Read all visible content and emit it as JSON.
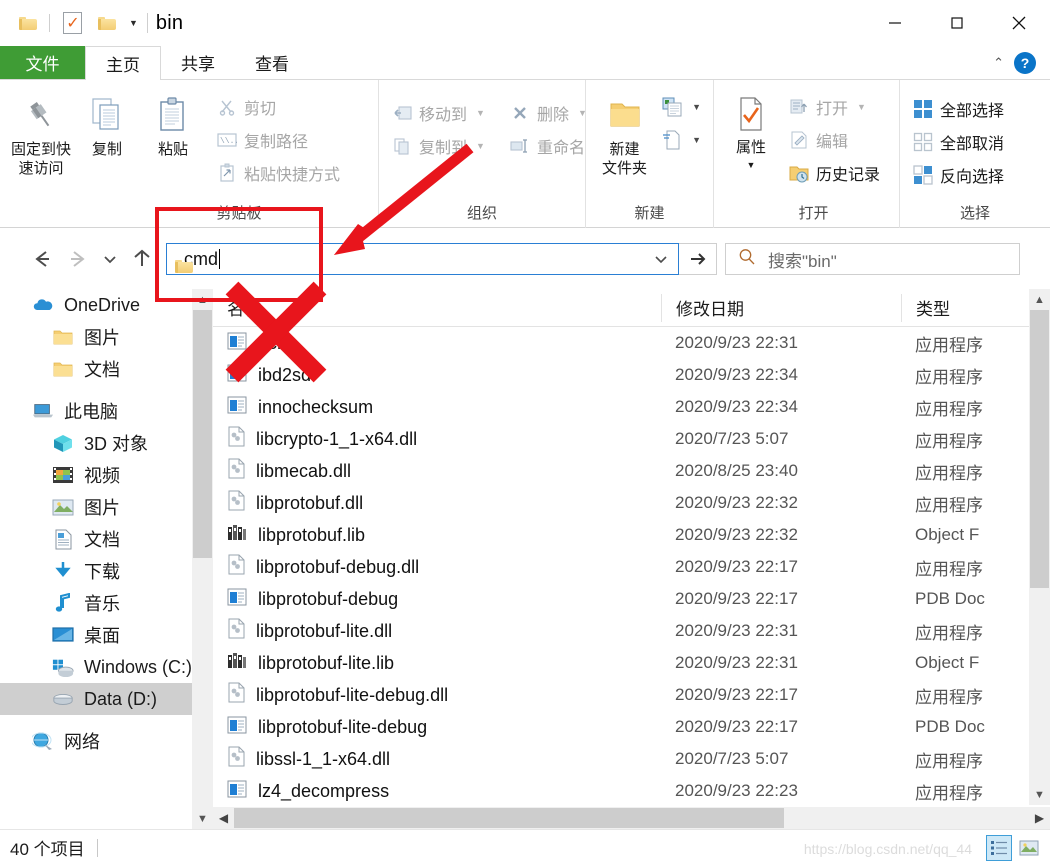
{
  "window": {
    "title": "bin",
    "controls": {
      "minimize": "minimize-button",
      "maximize": "maximize-button",
      "close": "close-button"
    }
  },
  "quick_access_toolbar": {
    "items": [
      "folder-icon",
      "properties-icon",
      "new-folder-icon"
    ],
    "dropdown": "⌄"
  },
  "tabs": [
    {
      "label": "文件",
      "active": false,
      "kind": "file"
    },
    {
      "label": "主页",
      "active": true,
      "kind": "normal"
    },
    {
      "label": "共享",
      "active": false,
      "kind": "normal"
    },
    {
      "label": "查看",
      "active": false,
      "kind": "normal"
    }
  ],
  "tab_right": {
    "collapse": "⌃",
    "help": "?"
  },
  "ribbon": {
    "groups": [
      {
        "label": "剪贴板",
        "big_buttons": [
          {
            "label": "固定到快\n速访问",
            "line1": "固定到快",
            "line2": "速访问",
            "icon": "pin-icon"
          },
          {
            "label": "复制",
            "line1": "复制",
            "line2": "",
            "icon": "copy-icon"
          },
          {
            "label": "粘贴",
            "line1": "粘贴",
            "line2": "",
            "icon": "paste-icon"
          }
        ],
        "small_buttons": [
          {
            "label": "剪切",
            "icon": "scissors-icon",
            "disabled": true,
            "caret": false
          },
          {
            "label": "复制路径",
            "icon": "copy-path-icon",
            "disabled": true,
            "caret": false
          },
          {
            "label": "粘贴快捷方式",
            "icon": "paste-shortcut-icon",
            "disabled": true,
            "caret": false
          }
        ]
      },
      {
        "label": "组织",
        "small_buttons": [
          {
            "label": "移动到",
            "icon": "move-to-icon",
            "disabled": true,
            "caret": true
          },
          {
            "label": "复制到",
            "icon": "copy-to-icon",
            "disabled": true,
            "caret": true
          },
          {
            "label": "删除",
            "icon": "delete-icon",
            "disabled": true,
            "caret": true
          },
          {
            "label": "重命名",
            "icon": "rename-icon",
            "disabled": true,
            "caret": false
          }
        ]
      },
      {
        "label": "新建",
        "big_buttons": [
          {
            "line1": "新建",
            "line2": "文件夹",
            "icon": "new-folder-icon"
          }
        ],
        "small_buttons": [
          {
            "label": "",
            "icon": "new-item-icon",
            "disabled": false,
            "caret": true
          },
          {
            "label": "",
            "icon": "easy-access-icon",
            "disabled": false,
            "caret": true
          }
        ]
      },
      {
        "label": "打开",
        "big_buttons": [
          {
            "line1": "属性",
            "line2": "",
            "icon": "properties-icon",
            "caret": true
          }
        ],
        "small_buttons": [
          {
            "label": "打开",
            "icon": "open-icon",
            "disabled": true,
            "caret": true
          },
          {
            "label": "编辑",
            "icon": "edit-icon",
            "disabled": true,
            "caret": false
          },
          {
            "label": "历史记录",
            "icon": "history-icon",
            "disabled": false,
            "caret": false
          }
        ]
      },
      {
        "label": "选择",
        "small_buttons": [
          {
            "label": "全部选择",
            "icon": "select-all-icon",
            "disabled": false,
            "caret": false
          },
          {
            "label": "全部取消",
            "icon": "select-none-icon",
            "disabled": false,
            "caret": false
          },
          {
            "label": "反向选择",
            "icon": "invert-selection-icon",
            "disabled": false,
            "caret": false
          }
        ]
      }
    ]
  },
  "navbar": {
    "back": "←",
    "forward": "→",
    "recent": "⌄",
    "up": "↑",
    "address_value": "cmd",
    "address_dropdown": "⌄",
    "go": "→",
    "search_placeholder": "搜索\"bin\""
  },
  "sidebar": {
    "items": [
      {
        "label": "OneDrive",
        "icon": "onedrive-cloud-icon",
        "indent": 0,
        "selected": false,
        "spacer_before": false
      },
      {
        "label": "图片",
        "icon": "folder-icon",
        "indent": 1,
        "selected": false,
        "spacer_before": false
      },
      {
        "label": "文档",
        "icon": "folder-icon",
        "indent": 1,
        "selected": false,
        "spacer_before": false
      },
      {
        "label": "此电脑",
        "icon": "this-pc-icon",
        "indent": 0,
        "selected": false,
        "spacer_before": true
      },
      {
        "label": "3D 对象",
        "icon": "3d-objects-icon",
        "indent": 1,
        "selected": false,
        "spacer_before": false
      },
      {
        "label": "视频",
        "icon": "videos-icon",
        "indent": 1,
        "selected": false,
        "spacer_before": false
      },
      {
        "label": "图片",
        "icon": "pictures-icon",
        "indent": 1,
        "selected": false,
        "spacer_before": false
      },
      {
        "label": "文档",
        "icon": "documents-icon",
        "indent": 1,
        "selected": false,
        "spacer_before": false
      },
      {
        "label": "下载",
        "icon": "downloads-icon",
        "indent": 1,
        "selected": false,
        "spacer_before": false
      },
      {
        "label": "音乐",
        "icon": "music-icon",
        "indent": 1,
        "selected": false,
        "spacer_before": false
      },
      {
        "label": "桌面",
        "icon": "desktop-icon",
        "indent": 1,
        "selected": false,
        "spacer_before": false
      },
      {
        "label": "Windows (C:)",
        "icon": "windows-drive-icon",
        "indent": 1,
        "selected": false,
        "spacer_before": false
      },
      {
        "label": "Data (D:)",
        "icon": "drive-icon",
        "indent": 1,
        "selected": true,
        "spacer_before": false
      },
      {
        "label": "网络",
        "icon": "network-icon",
        "indent": 0,
        "selected": false,
        "spacer_before": true
      }
    ]
  },
  "filelist": {
    "columns": [
      {
        "key": "name",
        "label": "名称"
      },
      {
        "key": "date",
        "label": "修改日期"
      },
      {
        "key": "type",
        "label": "类型"
      }
    ],
    "sort_indicator": "⌃",
    "rows": [
      {
        "name": "echo",
        "date": "2020/9/23 22:31",
        "type": "应用程序",
        "icon": "exe-icon"
      },
      {
        "name": "ibd2sdi",
        "date": "2020/9/23 22:34",
        "type": "应用程序",
        "icon": "exe-icon"
      },
      {
        "name": "innochecksum",
        "date": "2020/9/23 22:34",
        "type": "应用程序",
        "icon": "exe-icon"
      },
      {
        "name": "libcrypto-1_1-x64.dll",
        "date": "2020/7/23 5:07",
        "type": "应用程序",
        "icon": "dll-icon"
      },
      {
        "name": "libmecab.dll",
        "date": "2020/8/25 23:40",
        "type": "应用程序",
        "icon": "dll-icon"
      },
      {
        "name": "libprotobuf.dll",
        "date": "2020/9/23 22:32",
        "type": "应用程序",
        "icon": "dll-icon"
      },
      {
        "name": "libprotobuf.lib",
        "date": "2020/9/23 22:32",
        "type": "Object F",
        "icon": "lib-icon"
      },
      {
        "name": "libprotobuf-debug.dll",
        "date": "2020/9/23 22:17",
        "type": "应用程序",
        "icon": "dll-icon"
      },
      {
        "name": "libprotobuf-debug",
        "date": "2020/9/23 22:17",
        "type": "PDB Doc",
        "icon": "exe-icon"
      },
      {
        "name": "libprotobuf-lite.dll",
        "date": "2020/9/23 22:31",
        "type": "应用程序",
        "icon": "dll-icon"
      },
      {
        "name": "libprotobuf-lite.lib",
        "date": "2020/9/23 22:31",
        "type": "Object F",
        "icon": "lib-icon"
      },
      {
        "name": "libprotobuf-lite-debug.dll",
        "date": "2020/9/23 22:17",
        "type": "应用程序",
        "icon": "dll-icon"
      },
      {
        "name": "libprotobuf-lite-debug",
        "date": "2020/9/23 22:17",
        "type": "PDB Doc",
        "icon": "exe-icon"
      },
      {
        "name": "libssl-1_1-x64.dll",
        "date": "2020/7/23 5:07",
        "type": "应用程序",
        "icon": "dll-icon"
      },
      {
        "name": "lz4_decompress",
        "date": "2020/9/23 22:23",
        "type": "应用程序",
        "icon": "exe-icon"
      }
    ]
  },
  "statusbar": {
    "item_count": "40 个项目",
    "view_details": "details-view-icon",
    "view_thumbnails": "thumbnail-view-icon"
  },
  "watermark": {
    "text": "https://blog.csdn.net/qq_44"
  },
  "annotations": {
    "red_box": "red-highlight-box",
    "red_arrow": "red-arrow-pointing-to-address-bar",
    "red_x": "red-x-mark"
  },
  "colors": {
    "file_tab_green": "#3f9c35",
    "accent_blue": "#0a74c8",
    "annotation_red": "#e8151c",
    "selection_gray": "#cfcfcf"
  }
}
